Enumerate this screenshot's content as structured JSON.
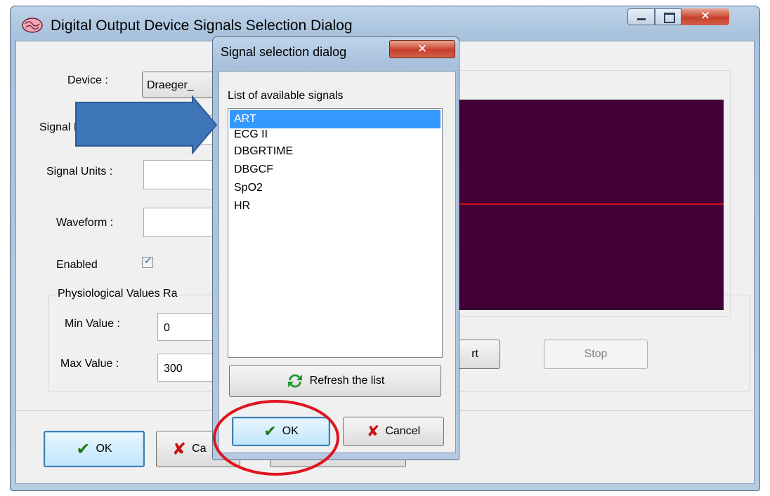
{
  "main_window": {
    "title": "Digital Output Device Signals Selection Dialog",
    "icon": "app-brain-icon"
  },
  "form": {
    "device_label": "Device :",
    "device_value": "Draeger_",
    "signal_name_label": "Signal Name :",
    "signal_units_label": "Signal Units :",
    "waveform_label": "Waveform :",
    "enabled_label": "Enabled",
    "enabled_checked": true,
    "range_group_label": "Physiological Values Ra",
    "min_label": "Min Value :",
    "min_value": "0",
    "max_label": "Max Value :",
    "max_value": "300"
  },
  "waveform_panel": {
    "background": "#420036",
    "trace_color": "#d0101e",
    "start_label_partial": "rt",
    "stop_label": "Stop"
  },
  "footer": {
    "ok_label": "OK",
    "cancel_label_partial": "Ca"
  },
  "signal_dialog": {
    "title": "Signal selection dialog",
    "list_caption": "List of available signals",
    "signals": [
      "ART",
      "ECG II",
      "DBGRTIME",
      "DBGCF",
      "SpO2",
      "HR"
    ],
    "selected_index": 0,
    "refresh_label": "Refresh the list",
    "ok_label": "OK",
    "cancel_label": "Cancel"
  },
  "annotations": {
    "arrow_color": "#3e74b8",
    "ellipse_color": "#e0141e"
  }
}
